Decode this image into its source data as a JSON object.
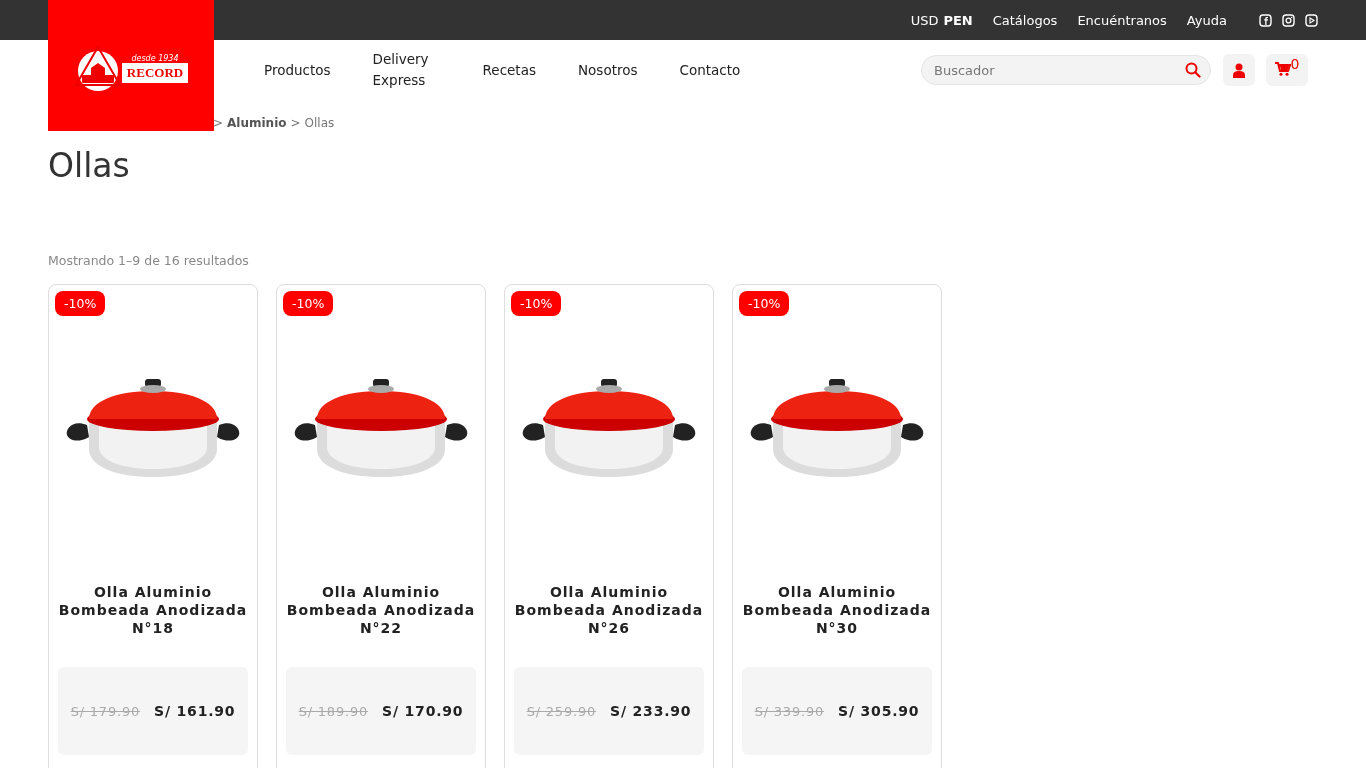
{
  "top_bar": {
    "currencies": [
      {
        "label": "USD",
        "selected": false
      },
      {
        "label": "PEN",
        "selected": true
      }
    ],
    "links": [
      "Catálogos",
      "Encuéntranos",
      "Ayuda"
    ]
  },
  "logo": {
    "tagline": "desde 1934",
    "name": "RECORD"
  },
  "nav": [
    "Productos",
    "Delivery Express",
    "Recetas",
    "Nosotros",
    "Contacto"
  ],
  "search": {
    "placeholder": "Buscador"
  },
  "cart": {
    "count": "0"
  },
  "breadcrumb": {
    "separator": ">",
    "items": [
      {
        "label": "Aluminio",
        "current": false
      },
      {
        "label": "Ollas",
        "current": true
      }
    ]
  },
  "page_title": "Ollas",
  "result_count": "Mostrando 1–9 de 16 resultados",
  "products": [
    {
      "badge": "-10%",
      "name": "Olla Aluminio Bombeada Anodizada N°18",
      "old_price": "S/ 179.90",
      "price": "S/ 161.90"
    },
    {
      "badge": "-10%",
      "name": "Olla Aluminio Bombeada Anodizada N°22",
      "old_price": "S/ 189.90",
      "price": "S/ 170.90"
    },
    {
      "badge": "-10%",
      "name": "Olla Aluminio Bombeada Anodizada N°26",
      "old_price": "S/ 259.90",
      "price": "S/ 233.90"
    },
    {
      "badge": "-10%",
      "name": "Olla Aluminio Bombeada Anodizada N°30",
      "old_price": "S/ 339.90",
      "price": "S/ 305.90"
    }
  ]
}
